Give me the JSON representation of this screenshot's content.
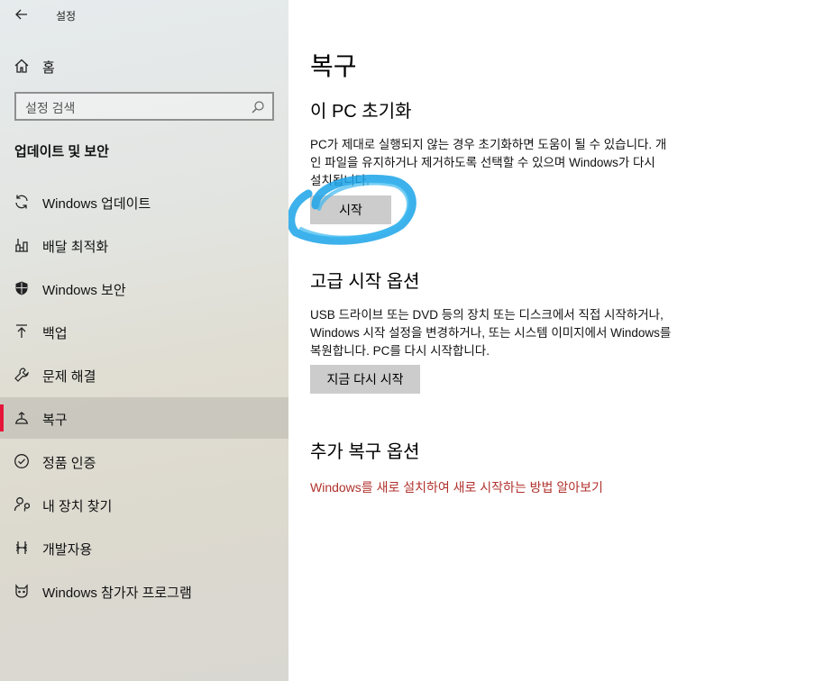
{
  "window": {
    "title": "설정",
    "back_icon": "back-arrow-icon"
  },
  "sidebar": {
    "home_label": "홈",
    "search_placeholder": "설정 검색",
    "section_title": "업데이트 및 보안",
    "items": [
      {
        "label": "Windows 업데이트",
        "icon": "refresh-icon",
        "active": false
      },
      {
        "label": "배달 최적화",
        "icon": "delivery-icon",
        "active": false
      },
      {
        "label": "Windows 보안",
        "icon": "shield-icon",
        "active": false
      },
      {
        "label": "백업",
        "icon": "backup-arrow-icon",
        "active": false
      },
      {
        "label": "문제 해결",
        "icon": "wrench-icon",
        "active": false
      },
      {
        "label": "복구",
        "icon": "recovery-icon",
        "active": true
      },
      {
        "label": "정품 인증",
        "icon": "check-circle-icon",
        "active": false
      },
      {
        "label": "내 장치 찾기",
        "icon": "person-location-icon",
        "active": false
      },
      {
        "label": "개발자용",
        "icon": "developer-icon",
        "active": false
      },
      {
        "label": "Windows 참가자 프로그램",
        "icon": "insider-cat-icon",
        "active": false
      }
    ],
    "accent_color": "#e5163a"
  },
  "main": {
    "title": "복구",
    "reset": {
      "heading": "이 PC 초기화",
      "desc_line1": "PC가 제대로 실행되지 않는 경우 초기화하면 도움이 될 수 있습니다. 개",
      "desc_line2": "인 파일을 유지하거나 제거하도록 선택할 수 있으며 Windows가 다시",
      "desc_line3": "설치됩니다.",
      "button": "시작"
    },
    "advanced": {
      "heading": "고급 시작 옵션",
      "desc_line1": "USB 드라이브 또는 DVD 등의 장치 또는 디스크에서 직접 시작하거나,",
      "desc_line2": "Windows 시작 설정을 변경하거나, 또는 시스템 이미지에서 Windows를",
      "desc_line3": "복원합니다. PC를 다시 시작합니다.",
      "button": "지금 다시 시작"
    },
    "more": {
      "heading": "추가 복구 옵션",
      "link": "Windows를 새로 설치하여 새로 시작하는 방법 알아보기"
    },
    "link_color": "#b0322d",
    "annotation_color": "#1aa3e8"
  }
}
